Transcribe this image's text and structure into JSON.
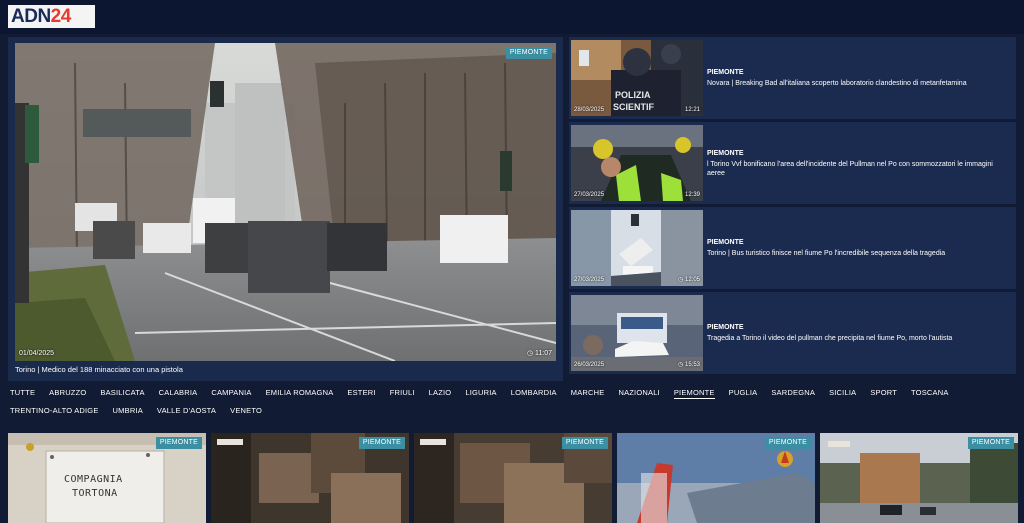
{
  "header": {
    "logo_text": "ADN",
    "logo_accent": "24",
    "accent_color": "#e63a2e"
  },
  "hero": {
    "badge": "PIEMONTE",
    "date": "01/04/2025",
    "time": "11:07",
    "caption": "Torino | Medico del 188 minacciato con una pistola"
  },
  "side_items": [
    {
      "date": "28/03/2025",
      "time": "12:21",
      "region": "PIEMONTE",
      "title": "Novara | Breaking Bad all'italiana scoperto laboratorio clandestino di metanfetamina"
    },
    {
      "date": "27/03/2025",
      "time": "12:39",
      "region": "PIEMONTE",
      "title": "l Torino Vvf bonificano l'area dell'incidente del Pullman nel Po con sommozzatori le immagini aeree"
    },
    {
      "date": "27/03/2025",
      "time": "12:05",
      "region": "PIEMONTE",
      "title": "Torino | Bus turistico finisce nel fiume Po l'incredibile sequenza della tragedia"
    },
    {
      "date": "26/03/2025",
      "time": "15:53",
      "region": "PIEMONTE",
      "title": "Tragedia a Torino il video del pullman che precipita nel fiume Po, morto l'autista"
    }
  ],
  "regions": {
    "active": "PIEMONTE",
    "items": [
      "TUTTE",
      "ABRUZZO",
      "BASILICATA",
      "CALABRIA",
      "CAMPANIA",
      "EMILIA ROMAGNA",
      "ESTERI",
      "FRIULI",
      "LAZIO",
      "LIGURIA",
      "LOMBARDIA",
      "MARCHE",
      "NAZIONALI",
      "PIEMONTE",
      "PUGLIA",
      "SARDEGNA",
      "SICILIA",
      "SPORT",
      "TOSCANA",
      "TRENTINO-ALTO ADIGE",
      "UMBRIA",
      "VALLE D'AOSTA",
      "VENETO"
    ]
  },
  "bottom_cards": [
    {
      "badge": "PIEMONTE",
      "sign_text_1": "COMPAGNIA",
      "sign_text_2": "TORTONA"
    },
    {
      "badge": "PIEMONTE"
    },
    {
      "badge": "PIEMONTE"
    },
    {
      "badge": "PIEMONTE"
    },
    {
      "badge": "PIEMONTE"
    }
  ]
}
